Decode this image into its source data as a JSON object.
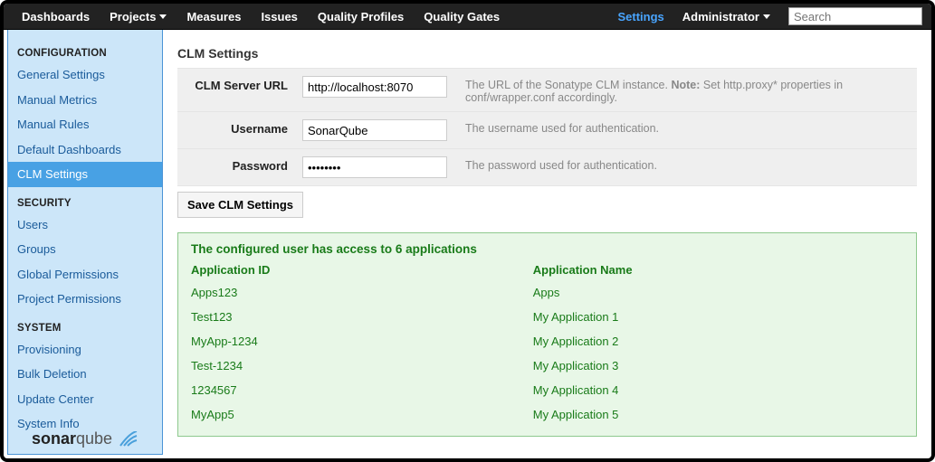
{
  "topnav": {
    "left": [
      {
        "label": "Dashboards",
        "caret": false
      },
      {
        "label": "Projects",
        "caret": true
      },
      {
        "label": "Measures",
        "caret": false
      },
      {
        "label": "Issues",
        "caret": false
      },
      {
        "label": "Quality Profiles",
        "caret": false
      },
      {
        "label": "Quality Gates",
        "caret": false
      }
    ],
    "settings_label": "Settings",
    "admin_label": "Administrator",
    "search_placeholder": "Search"
  },
  "sidebar": {
    "sections": [
      {
        "title": "CONFIGURATION",
        "items": [
          {
            "label": "General Settings",
            "active": false
          },
          {
            "label": "Manual Metrics",
            "active": false
          },
          {
            "label": "Manual Rules",
            "active": false
          },
          {
            "label": "Default Dashboards",
            "active": false
          },
          {
            "label": "CLM Settings",
            "active": true
          }
        ]
      },
      {
        "title": "SECURITY",
        "items": [
          {
            "label": "Users",
            "active": false
          },
          {
            "label": "Groups",
            "active": false
          },
          {
            "label": "Global Permissions",
            "active": false
          },
          {
            "label": "Project Permissions",
            "active": false
          }
        ]
      },
      {
        "title": "SYSTEM",
        "items": [
          {
            "label": "Provisioning",
            "active": false
          },
          {
            "label": "Bulk Deletion",
            "active": false
          },
          {
            "label": "Update Center",
            "active": false
          },
          {
            "label": "System Info",
            "active": false
          }
        ]
      }
    ],
    "logo_text_a": "sonar",
    "logo_text_b": "qube"
  },
  "page": {
    "title": "CLM Settings",
    "form": {
      "server_url": {
        "label": "CLM Server URL",
        "value": "http://localhost:8070",
        "help_a": "The URL of the Sonatype CLM instance. ",
        "help_note_label": "Note:",
        "help_b": " Set http.proxy* properties in conf/wrapper.conf accordingly."
      },
      "username": {
        "label": "Username",
        "value": "SonarQube",
        "help": "The username used for authentication."
      },
      "password": {
        "label": "Password",
        "value": "••••••••",
        "help": "The password used for authentication."
      },
      "save_label": "Save CLM Settings"
    },
    "access": {
      "title": "The configured user has access to 6 applications",
      "col_id": "Application ID",
      "col_name": "Application Name",
      "rows": [
        {
          "id": "Apps123",
          "name": "Apps"
        },
        {
          "id": "Test123",
          "name": "My Application 1"
        },
        {
          "id": "MyApp-1234",
          "name": "My Application 2"
        },
        {
          "id": "Test-1234",
          "name": "My Application 3"
        },
        {
          "id": "1234567",
          "name": "My Application 4"
        },
        {
          "id": "MyApp5",
          "name": "My Application 5"
        }
      ]
    }
  }
}
